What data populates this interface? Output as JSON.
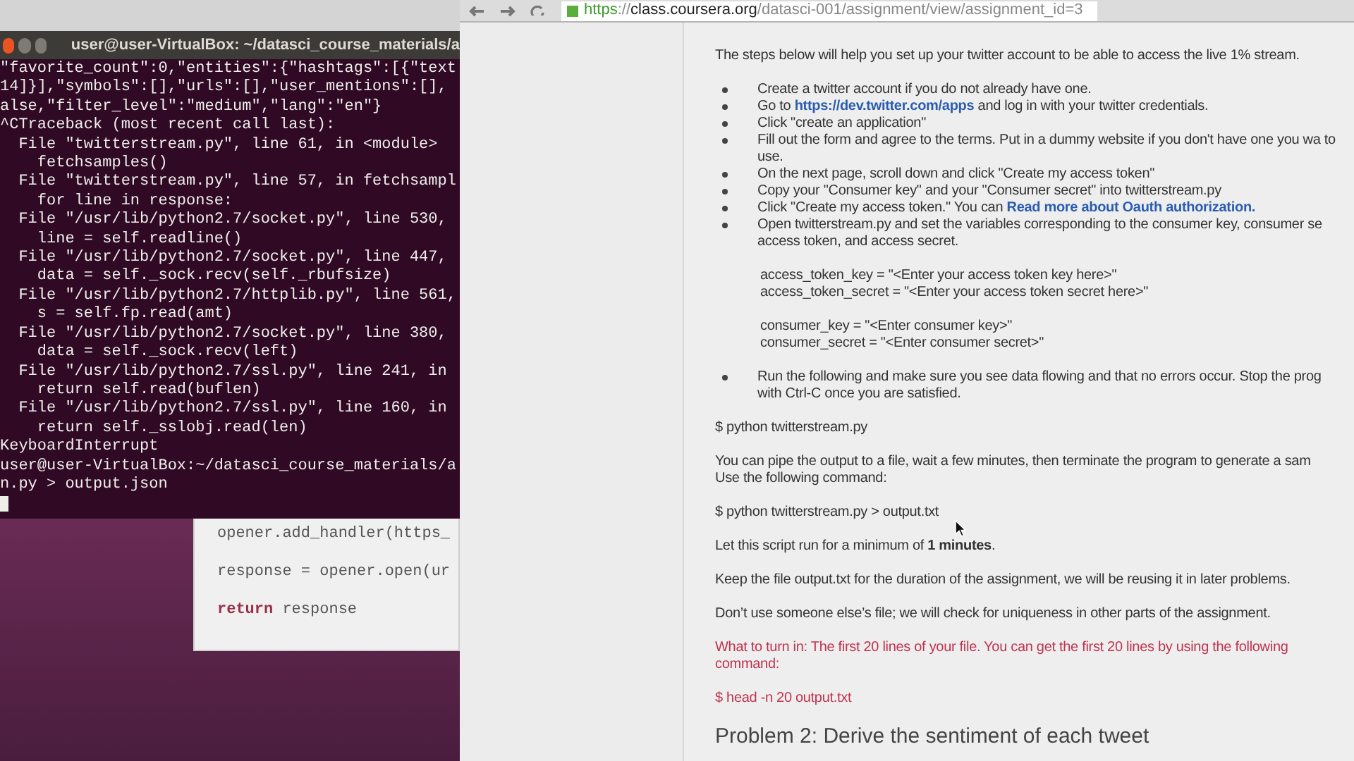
{
  "terminal": {
    "title": "user@user-VirtualBox: ~/datasci_course_materials/a",
    "lines": [
      "\"favorite_count\":0,\"entities\":{\"hashtags\":[{\"text",
      "14]}],\"symbols\":[],\"urls\":[],\"user_mentions\":[],",
      "alse,\"filter_level\":\"medium\",\"lang\":\"en\"}",
      "^CTraceback (most recent call last):",
      "  File \"twitterstream.py\", line 61, in <module>",
      "    fetchsamples()",
      "  File \"twitterstream.py\", line 57, in fetchsampl",
      "    for line in response:",
      "  File \"/usr/lib/python2.7/socket.py\", line 530,",
      "    line = self.readline()",
      "  File \"/usr/lib/python2.7/socket.py\", line 447,",
      "    data = self._sock.recv(self._rbufsize)",
      "  File \"/usr/lib/python2.7/httplib.py\", line 561,",
      "    s = self.fp.read(amt)",
      "  File \"/usr/lib/python2.7/socket.py\", line 380,",
      "    data = self._sock.recv(left)",
      "  File \"/usr/lib/python2.7/ssl.py\", line 241, in",
      "    return self.read(buflen)",
      "  File \"/usr/lib/python2.7/ssl.py\", line 160, in",
      "    return self._sslobj.read(len)",
      "KeyboardInterrupt",
      "user@user-VirtualBox:~/datasci_course_materials/a",
      "n.py > output.json"
    ]
  },
  "editor": {
    "lines": [
      [
        {
          "kind": "plain",
          "text": "opener.add_handler(https_"
        }
      ],
      [
        {
          "kind": "plain",
          "text": "response = opener.open(ur"
        }
      ],
      [
        {
          "kind": "keyword",
          "text": "return"
        },
        {
          "kind": "plain",
          "text": " response"
        }
      ]
    ]
  },
  "browser": {
    "url": [
      {
        "kind": "secure",
        "text": "https"
      },
      {
        "kind": "dim",
        "text": "://"
      },
      {
        "kind": "host",
        "text": "class.coursera.org"
      },
      {
        "kind": "dim",
        "text": "/datasci-001/assignment/view/assignment_id=3"
      }
    ],
    "blocks": [
      {
        "kind": "paragraph",
        "text": "The steps below will help you set up your twitter account to be able to access the live 1% stream."
      },
      {
        "kind": "bullets",
        "items": [
          [
            {
              "kind": "text",
              "text": "Create a twitter account if you do not already have one."
            }
          ],
          [
            {
              "kind": "text",
              "text": "Go to "
            },
            {
              "kind": "link",
              "text": "https://dev.twitter.com/apps"
            },
            {
              "kind": "text",
              "text": " and log in with your twitter credentials."
            }
          ],
          [
            {
              "kind": "text",
              "text": "Click \"create an application\""
            }
          ],
          [
            {
              "kind": "text",
              "text": "Fill out the form and agree to the terms. Put in a dummy website if you don't have one you wa to use."
            }
          ],
          [
            {
              "kind": "text",
              "text": "On the next page, scroll down and click \"Create my access token\""
            }
          ],
          [
            {
              "kind": "text",
              "text": "Copy your \"Consumer key\" and your \"Consumer secret\" into twitterstream.py"
            }
          ],
          [
            {
              "kind": "text",
              "text": "Click \"Create my access token.\" You can "
            },
            {
              "kind": "link",
              "text": "Read more about Oauth authorization."
            }
          ],
          [
            {
              "kind": "text",
              "text": "Open twitterstream.py and set the variables corresponding to the consumer key, consumer se access token, and access secret."
            }
          ]
        ]
      },
      {
        "kind": "code",
        "groups": [
          [
            "access_token_key = \"<Enter your access token key here>\"",
            "access_token_secret = \"<Enter your access token secret here>\""
          ],
          [
            "consumer_key = \"<Enter consumer key>\"",
            "consumer_secret = \"<Enter consumer secret>\""
          ]
        ]
      },
      {
        "kind": "bullets",
        "items": [
          [
            {
              "kind": "text",
              "text": "Run the following and make sure you see data flowing and that no errors occur.  Stop the prog with Ctrl-C once you are satisfied."
            }
          ]
        ]
      },
      {
        "kind": "paragraph",
        "text": "$ python twitterstream.py"
      },
      {
        "kind": "paragraph",
        "text": "You can pipe the output to a file, wait a few minutes, then terminate the program to generate a sam Use the following command:"
      },
      {
        "kind": "paragraph",
        "text": "$ python twitterstream.py > output.txt"
      },
      {
        "kind": "paragraph",
        "text": "Let this script run for a minimum of **1 minutes**."
      },
      {
        "kind": "paragraph",
        "text": "Keep the file output.txt for the duration of the assignment, we will be reusing it in later problems."
      },
      {
        "kind": "paragraph",
        "text": "Don’t use someone else’s file; we will check for uniqueness in other parts of the assignment."
      },
      {
        "kind": "warning",
        "text": "What to turn in: The first 20 lines of your file. You can get the first 20 lines by using the following command:"
      },
      {
        "kind": "warning",
        "text": "$ head -n 20 output.txt"
      },
      {
        "kind": "heading",
        "text": "Problem 2: Derive the sentiment of each tweet"
      }
    ]
  }
}
